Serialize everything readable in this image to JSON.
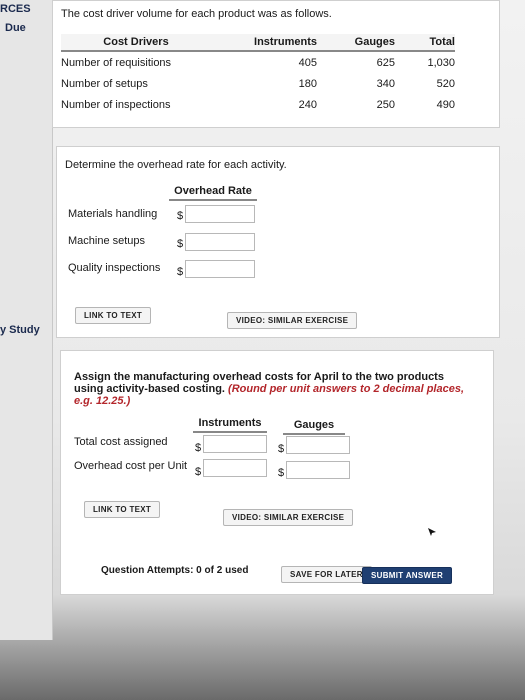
{
  "sidebar": {
    "label_resources": "RCES",
    "label_due": "Due",
    "label_study": "y Study"
  },
  "section1": {
    "intro": "The cost driver volume for each product was as follows.",
    "headers": [
      "Cost Drivers",
      "Instruments",
      "Gauges",
      "Total"
    ],
    "rows": [
      {
        "label": "Number of requisitions",
        "instruments": "405",
        "gauges": "625",
        "total": "1,030"
      },
      {
        "label": "Number of setups",
        "instruments": "180",
        "gauges": "340",
        "total": "520"
      },
      {
        "label": "Number of inspections",
        "instruments": "240",
        "gauges": "250",
        "total": "490"
      }
    ]
  },
  "section2": {
    "question": "Determine the overhead rate for each activity.",
    "column_header": "Overhead Rate",
    "rows": [
      {
        "label": "Materials handling",
        "currency": "$",
        "value": ""
      },
      {
        "label": "Machine setups",
        "currency": "$",
        "value": ""
      },
      {
        "label": "Quality inspections",
        "currency": "$",
        "value": ""
      }
    ],
    "link_to_text": "LINK TO TEXT",
    "video": "VIDEO: SIMILAR EXERCISE"
  },
  "section3": {
    "question_main": "Assign the manufacturing overhead costs for April to the two products using activity-based costing.",
    "question_note": "(Round per unit answers to 2 decimal places, e.g. 12.25.)",
    "col_instruments": "Instruments",
    "col_gauges": "Gauges",
    "rows": [
      {
        "label": "Total cost assigned",
        "currency": "$",
        "instruments": "",
        "gauges": ""
      },
      {
        "label": "Overhead cost per Unit",
        "currency": "$",
        "instruments": "",
        "gauges": ""
      }
    ],
    "link_to_text": "LINK TO TEXT",
    "video": "VIDEO: SIMILAR EXERCISE"
  },
  "footer": {
    "attempts": "Question Attempts: 0 of 2 used",
    "save": "SAVE FOR LATER",
    "submit": "SUBMIT ANSWER"
  }
}
